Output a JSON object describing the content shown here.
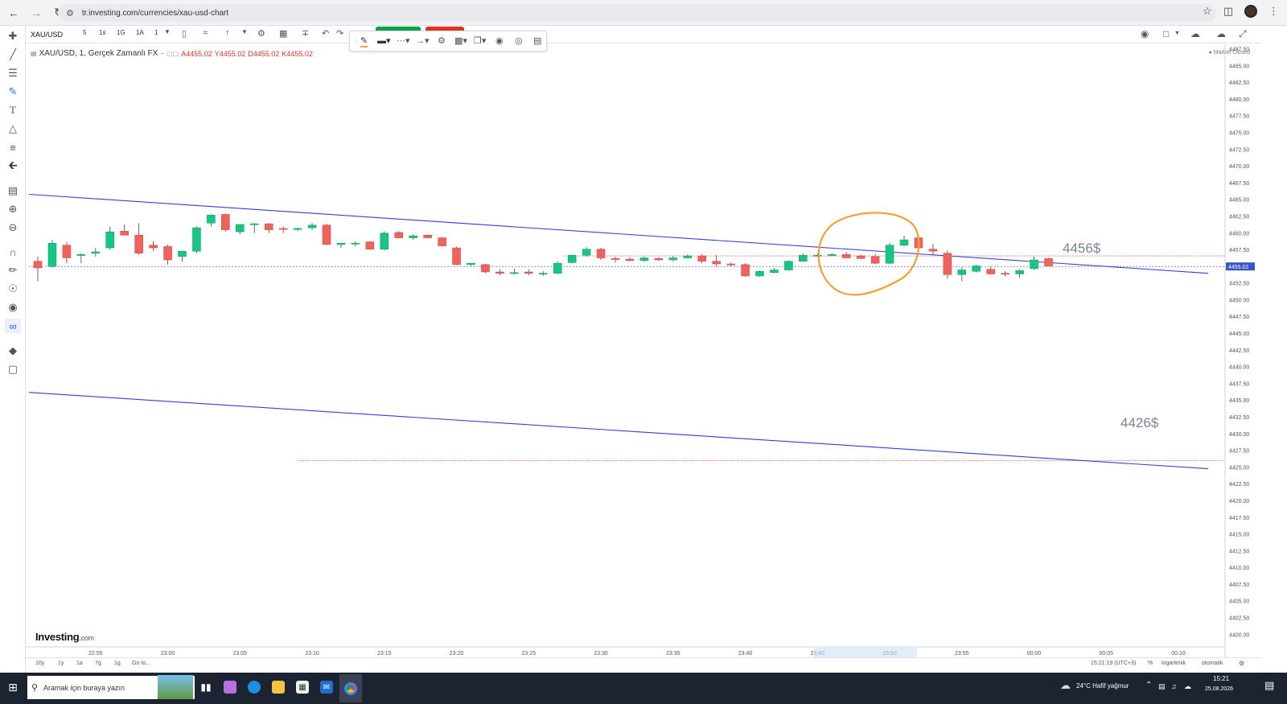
{
  "browser": {
    "url": "tr.investing.com/currencies/xau-usd-chart"
  },
  "toolbar": {
    "symbol": "XAU/USD",
    "timeframes": [
      "5",
      "1s",
      "1G",
      "1A",
      "1"
    ]
  },
  "legend": {
    "title": "XAU/USD, 1, Gerçek Zamanlı FX",
    "open": "A4455.02",
    "high": "Y4455.02",
    "low": "D4455.02",
    "close": "K4455.02"
  },
  "market_status": "Market Closed",
  "brand": {
    "name": "Investing",
    "suffix": ".com"
  },
  "annotations": {
    "upper_target": "4456$",
    "lower_target": "4426$"
  },
  "current_price_label": "4455.02",
  "range_bar": {
    "ranges": [
      "10y",
      "1y",
      "1a",
      "7g",
      "1g",
      "Go to..."
    ],
    "clock": "15:21:19 (UTC+3)",
    "percent": "%",
    "log": "logaritmik",
    "auto": "otomatik"
  },
  "colors": {
    "up": "#16c784",
    "down": "#f0625c",
    "trendline": "#3b3bd6",
    "annotation_circle": "#f5a030",
    "price_tag": "#3a55c4"
  },
  "taskbar": {
    "search_placeholder": "Aramak için buraya yazın",
    "weather": "24°C  Hafif yağmur",
    "time": "15:21",
    "date": "25.08.2026"
  },
  "chart_data": {
    "type": "candlestick",
    "y_axis": {
      "min": 4400,
      "max": 4487.5,
      "step": 2.5
    },
    "x_ticks": [
      "22:55",
      "23:00",
      "23:05",
      "23:10",
      "23:15",
      "23:20",
      "23:25",
      "23:30",
      "23:35",
      "23:40",
      "23:45",
      "23:50",
      "23:55",
      "00:00",
      "00:05",
      "00:10"
    ],
    "x_start_label": "22:55",
    "candles": [
      {
        "o": 4455.8,
        "h": 4456.5,
        "l": 4452.8,
        "c": 4454.8
      },
      {
        "o": 4455.0,
        "h": 4459.0,
        "l": 4454.8,
        "c": 4458.5
      },
      {
        "o": 4458.2,
        "h": 4458.7,
        "l": 4455.5,
        "c": 4456.3
      },
      {
        "o": 4456.8,
        "h": 4457.0,
        "l": 4455.5,
        "c": 4456.8
      },
      {
        "o": 4457.0,
        "h": 4457.8,
        "l": 4456.5,
        "c": 4457.2
      },
      {
        "o": 4457.8,
        "h": 4461.0,
        "l": 4457.5,
        "c": 4460.2
      },
      {
        "o": 4460.3,
        "h": 4461.3,
        "l": 4459.7,
        "c": 4459.7
      },
      {
        "o": 4459.7,
        "h": 4461.5,
        "l": 4456.8,
        "c": 4457.0
      },
      {
        "o": 4458.2,
        "h": 4458.8,
        "l": 4457.3,
        "c": 4457.8
      },
      {
        "o": 4458.0,
        "h": 4458.3,
        "l": 4455.3,
        "c": 4456.0
      },
      {
        "o": 4456.5,
        "h": 4457.0,
        "l": 4455.7,
        "c": 4457.3
      },
      {
        "o": 4457.3,
        "h": 4461.0,
        "l": 4457.0,
        "c": 4460.8
      },
      {
        "o": 4461.5,
        "h": 4462.8,
        "l": 4461.0,
        "c": 4462.7
      },
      {
        "o": 4462.8,
        "h": 4462.9,
        "l": 4460.2,
        "c": 4460.5
      },
      {
        "o": 4460.2,
        "h": 4461.2,
        "l": 4459.8,
        "c": 4461.3
      },
      {
        "o": 4461.3,
        "h": 4461.5,
        "l": 4460.0,
        "c": 4461.4
      },
      {
        "o": 4461.4,
        "h": 4461.5,
        "l": 4460.0,
        "c": 4460.5
      },
      {
        "o": 4460.7,
        "h": 4461.0,
        "l": 4460.0,
        "c": 4460.6
      },
      {
        "o": 4460.6,
        "h": 4460.8,
        "l": 4460.3,
        "c": 4460.7
      },
      {
        "o": 4460.8,
        "h": 4461.5,
        "l": 4460.5,
        "c": 4461.2
      },
      {
        "o": 4461.2,
        "h": 4461.4,
        "l": 4458.2,
        "c": 4458.3
      },
      {
        "o": 4458.3,
        "h": 4458.5,
        "l": 4457.8,
        "c": 4458.5
      },
      {
        "o": 4458.5,
        "h": 4458.8,
        "l": 4458.0,
        "c": 4458.5
      },
      {
        "o": 4458.7,
        "h": 4458.8,
        "l": 4457.5,
        "c": 4457.6
      },
      {
        "o": 4457.6,
        "h": 4460.3,
        "l": 4457.4,
        "c": 4460.0
      },
      {
        "o": 4460.1,
        "h": 4460.3,
        "l": 4459.2,
        "c": 4459.3
      },
      {
        "o": 4459.3,
        "h": 4459.8,
        "l": 4459.0,
        "c": 4459.6
      },
      {
        "o": 4459.7,
        "h": 4459.8,
        "l": 4459.2,
        "c": 4459.3
      },
      {
        "o": 4459.3,
        "h": 4459.4,
        "l": 4458.0,
        "c": 4458.1
      },
      {
        "o": 4457.8,
        "h": 4458.0,
        "l": 4455.2,
        "c": 4455.3
      },
      {
        "o": 4455.3,
        "h": 4455.5,
        "l": 4455.1,
        "c": 4455.5
      },
      {
        "o": 4455.3,
        "h": 4455.4,
        "l": 4454.0,
        "c": 4454.2
      },
      {
        "o": 4454.2,
        "h": 4454.6,
        "l": 4453.7,
        "c": 4454.0
      },
      {
        "o": 4454.0,
        "h": 4454.7,
        "l": 4453.8,
        "c": 4454.1
      },
      {
        "o": 4454.2,
        "h": 4454.6,
        "l": 4453.7,
        "c": 4454.0
      },
      {
        "o": 4453.9,
        "h": 4454.3,
        "l": 4453.6,
        "c": 4454.0
      },
      {
        "o": 4454.0,
        "h": 4455.8,
        "l": 4453.9,
        "c": 4455.5
      },
      {
        "o": 4455.6,
        "h": 4456.8,
        "l": 4455.5,
        "c": 4456.7
      },
      {
        "o": 4456.7,
        "h": 4457.9,
        "l": 4456.5,
        "c": 4457.6
      },
      {
        "o": 4457.6,
        "h": 4457.8,
        "l": 4456.0,
        "c": 4456.3
      },
      {
        "o": 4456.2,
        "h": 4456.5,
        "l": 4455.6,
        "c": 4456.1
      },
      {
        "o": 4456.1,
        "h": 4456.4,
        "l": 4455.8,
        "c": 4455.9
      },
      {
        "o": 4455.9,
        "h": 4456.5,
        "l": 4455.7,
        "c": 4456.3
      },
      {
        "o": 4456.2,
        "h": 4456.4,
        "l": 4455.9,
        "c": 4456.0
      },
      {
        "o": 4456.0,
        "h": 4456.6,
        "l": 4455.8,
        "c": 4456.3
      },
      {
        "o": 4456.3,
        "h": 4456.8,
        "l": 4456.2,
        "c": 4456.6
      },
      {
        "o": 4456.6,
        "h": 4456.9,
        "l": 4455.5,
        "c": 4455.8
      },
      {
        "o": 4455.8,
        "h": 4456.7,
        "l": 4455.0,
        "c": 4455.4
      },
      {
        "o": 4455.4,
        "h": 4455.6,
        "l": 4455.0,
        "c": 4455.3
      },
      {
        "o": 4455.3,
        "h": 4455.5,
        "l": 4453.5,
        "c": 4453.6
      },
      {
        "o": 4453.6,
        "h": 4454.4,
        "l": 4453.5,
        "c": 4454.3
      },
      {
        "o": 4454.1,
        "h": 4454.8,
        "l": 4454.0,
        "c": 4454.5
      },
      {
        "o": 4454.5,
        "h": 4455.9,
        "l": 4454.4,
        "c": 4455.8
      },
      {
        "o": 4455.8,
        "h": 4457.0,
        "l": 4455.7,
        "c": 4456.7
      },
      {
        "o": 4456.7,
        "h": 4457.0,
        "l": 4456.5,
        "c": 4456.7
      },
      {
        "o": 4456.7,
        "h": 4457.0,
        "l": 4456.5,
        "c": 4456.8
      },
      {
        "o": 4456.8,
        "h": 4457.2,
        "l": 4456.3,
        "c": 4456.3
      },
      {
        "o": 4456.6,
        "h": 4456.8,
        "l": 4456.2,
        "c": 4456.2
      },
      {
        "o": 4456.5,
        "h": 4456.9,
        "l": 4455.4,
        "c": 4455.5
      },
      {
        "o": 4455.5,
        "h": 4458.6,
        "l": 4455.4,
        "c": 4458.2
      },
      {
        "o": 4458.2,
        "h": 4459.6,
        "l": 4458.0,
        "c": 4459.0
      },
      {
        "o": 4459.3,
        "h": 4459.8,
        "l": 4457.5,
        "c": 4457.8
      },
      {
        "o": 4457.6,
        "h": 4458.4,
        "l": 4456.8,
        "c": 4457.3
      },
      {
        "o": 4457.0,
        "h": 4457.4,
        "l": 4453.2,
        "c": 4453.8
      },
      {
        "o": 4453.8,
        "h": 4454.9,
        "l": 4452.8,
        "c": 4454.5
      },
      {
        "o": 4454.3,
        "h": 4455.3,
        "l": 4454.1,
        "c": 4455.1
      },
      {
        "o": 4454.6,
        "h": 4455.0,
        "l": 4453.8,
        "c": 4453.9
      },
      {
        "o": 4454.0,
        "h": 4454.3,
        "l": 4453.5,
        "c": 4453.9
      },
      {
        "o": 4453.9,
        "h": 4454.6,
        "l": 4453.3,
        "c": 4454.4
      },
      {
        "o": 4454.7,
        "h": 4456.5,
        "l": 4454.5,
        "c": 4456.0
      },
      {
        "o": 4456.2,
        "h": 4456.3,
        "l": 4455.1,
        "c": 4455.1
      }
    ],
    "trendlines": [
      {
        "from": [
          0,
          4465.8
        ],
        "to": [
          80.5,
          4454.0
        ]
      },
      {
        "from": [
          0,
          4436.2
        ],
        "to": [
          80.5,
          4424.8
        ]
      }
    ],
    "horizontal_levels": [
      4455.02,
      4456.6,
      4426.0
    ]
  }
}
